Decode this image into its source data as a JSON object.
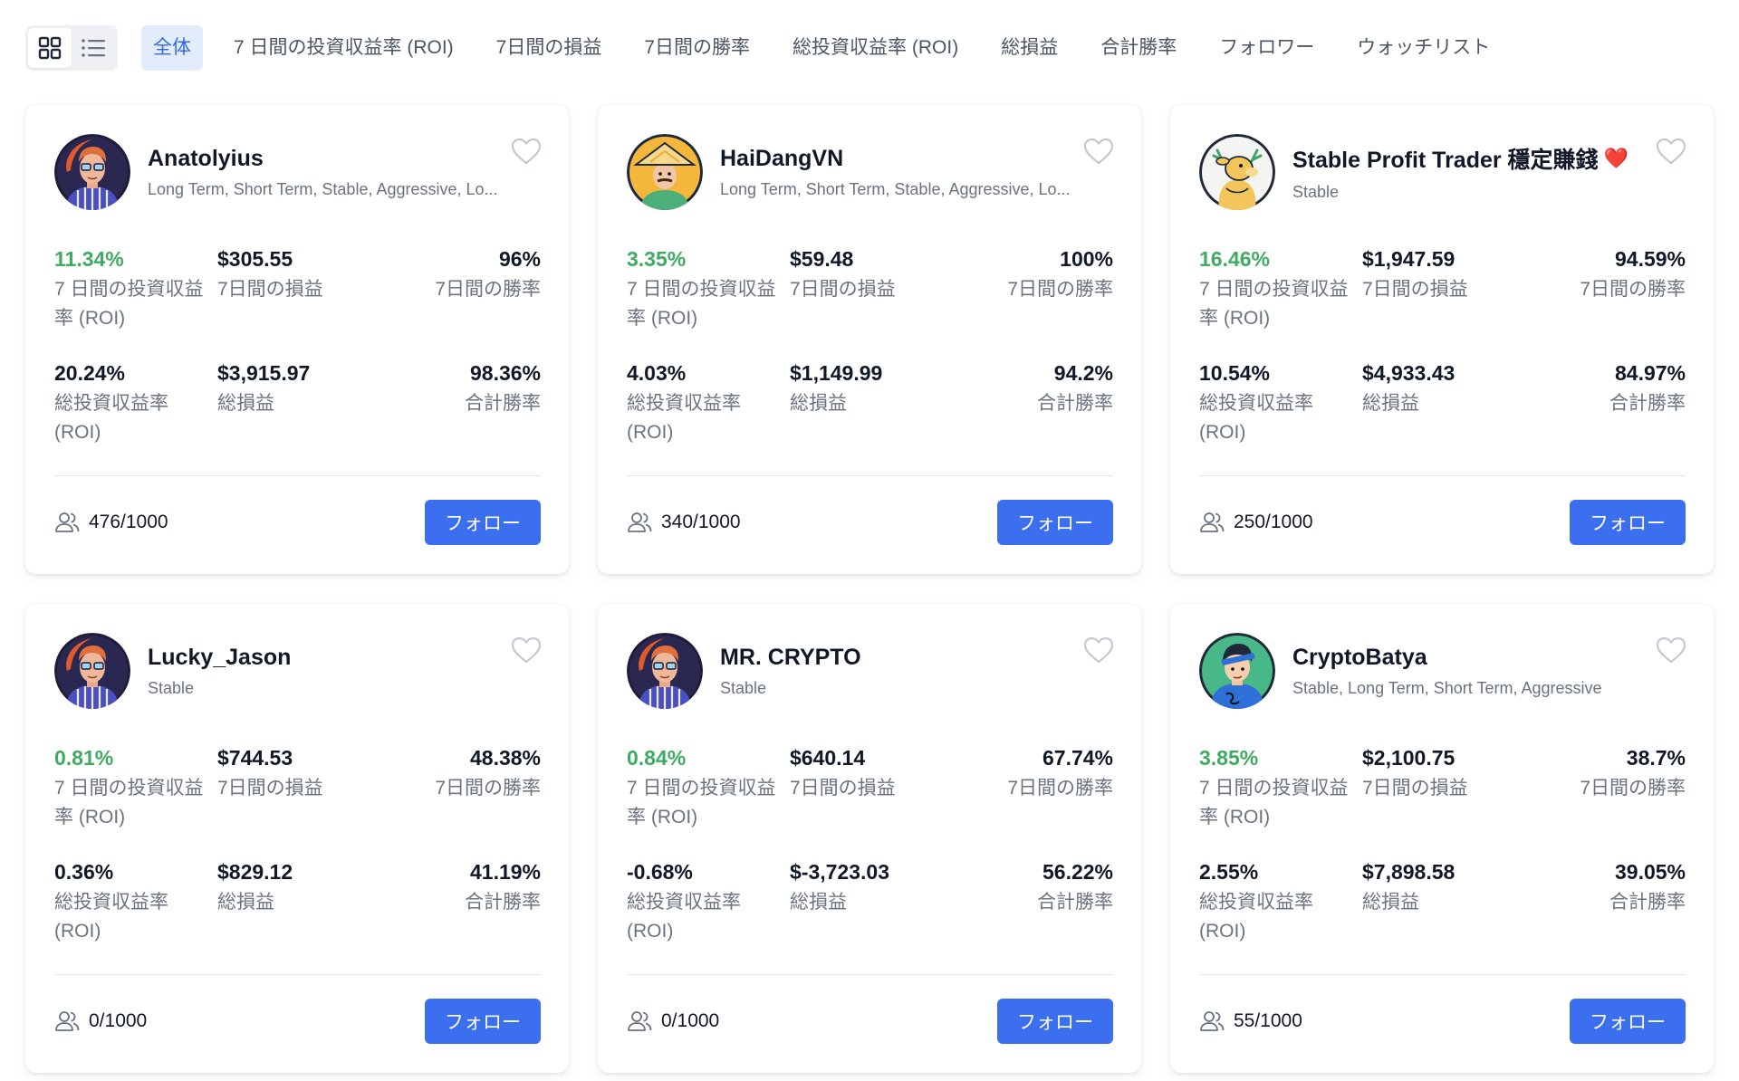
{
  "tabs": [
    "全体",
    "7 日間の投資収益率 (ROI)",
    "7日間の損益",
    "7日間の勝率",
    "総投資収益率 (ROI)",
    "総損益",
    "合計勝率",
    "フォロワー",
    "ウォッチリスト"
  ],
  "labels": {
    "roi7": "7 日間の投資収益率 (ROI)",
    "pnl7": "7日間の損益",
    "win7": "7日間の勝率",
    "roiTotal": "総投資収益率 (ROI)",
    "pnlTotal": "総損益",
    "winTotal": "合計勝率",
    "follow": "フォロー"
  },
  "accent_color": "#3b6ff0",
  "positive_color": "#3fab62",
  "traders": [
    {
      "name": "Anatolyius",
      "tags": "Long Term, Short Term, Stable, Aggressive, Lo...",
      "roi7": "11.34%",
      "pnl7": "$305.55",
      "win7": "96%",
      "roiTotal": "20.24%",
      "pnlTotal": "$3,915.97",
      "winTotal": "98.36%",
      "followers": "476/1000",
      "avatar": "nerd-avatar",
      "badge": ""
    },
    {
      "name": "HaiDangVN",
      "tags": "Long Term, Short Term, Stable, Aggressive, Lo...",
      "roi7": "3.35%",
      "pnl7": "$59.48",
      "win7": "100%",
      "roiTotal": "4.03%",
      "pnlTotal": "$1,149.99",
      "winTotal": "94.2%",
      "followers": "340/1000",
      "avatar": "conical-hat-avatar",
      "badge": ""
    },
    {
      "name": "Stable Profit Trader 穩定賺錢",
      "tags": "Stable",
      "roi7": "16.46%",
      "pnl7": "$1,947.59",
      "win7": "94.59%",
      "roiTotal": "10.54%",
      "pnlTotal": "$4,933.43",
      "winTotal": "84.97%",
      "followers": "250/1000",
      "avatar": "deer-avatar",
      "badge": "❤️"
    },
    {
      "name": "Lucky_Jason",
      "tags": "Stable",
      "roi7": "0.81%",
      "pnl7": "$744.53",
      "win7": "48.38%",
      "roiTotal": "0.36%",
      "pnlTotal": "$829.12",
      "winTotal": "41.19%",
      "followers": "0/1000",
      "avatar": "nerd-avatar",
      "badge": ""
    },
    {
      "name": "MR. CRYPTO",
      "tags": "Stable",
      "roi7": "0.84%",
      "pnl7": "$640.14",
      "win7": "67.74%",
      "roiTotal": "-0.68%",
      "pnlTotal": "$-3,723.03",
      "winTotal": "56.22%",
      "followers": "0/1000",
      "avatar": "nerd-avatar",
      "badge": ""
    },
    {
      "name": "CryptoBatya",
      "tags": "Stable, Long Term, Short Term, Aggressive",
      "roi7": "3.85%",
      "pnl7": "$2,100.75",
      "win7": "38.7%",
      "roiTotal": "2.55%",
      "pnlTotal": "$7,898.58",
      "winTotal": "39.05%",
      "followers": "55/1000",
      "avatar": "blue-hoodie-avatar",
      "badge": ""
    }
  ]
}
